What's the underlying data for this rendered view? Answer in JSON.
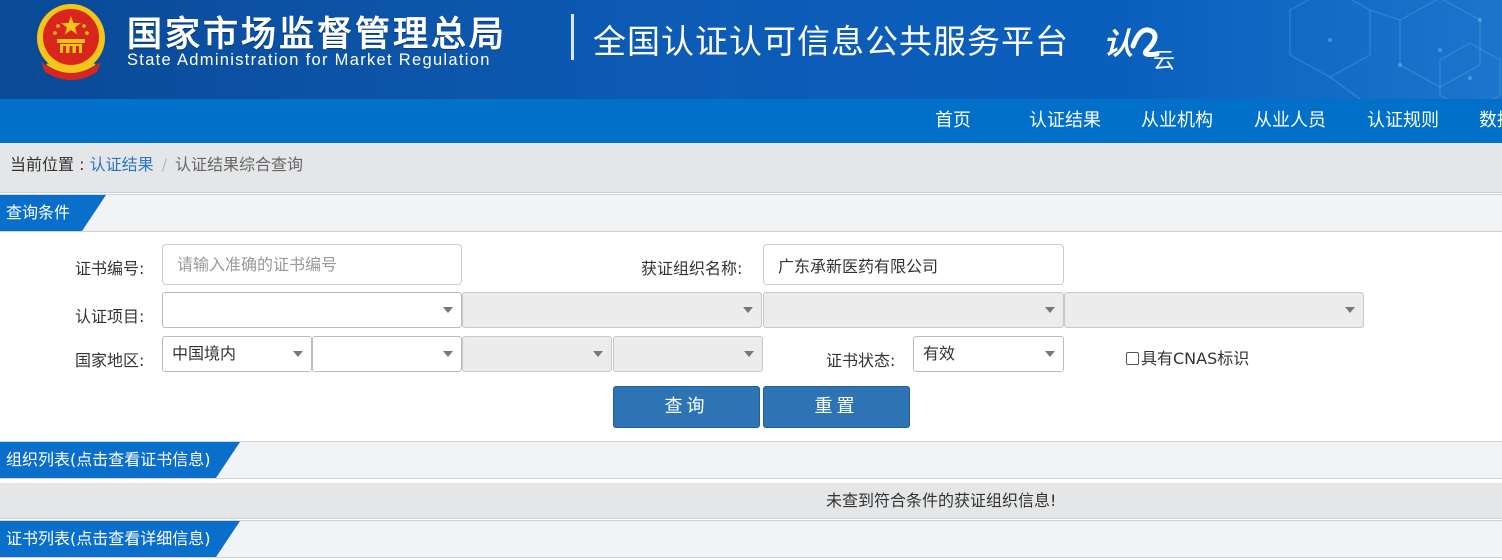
{
  "header": {
    "org_name_cn": "国家市场监督管理总局",
    "org_name_en": "State Administration  for  Market Regulation",
    "platform_title": "全国认证认可信息公共服务平台",
    "logo_text": "认",
    "logo_text_2": "云",
    "colors": {
      "header_blue": "#0d5bb5",
      "nav_blue": "#0070c8",
      "emblem_red": "#d8261c",
      "emblem_gold": "#f5c518"
    }
  },
  "nav": {
    "items": [
      {
        "label": "首页"
      },
      {
        "label": "认证结果"
      },
      {
        "label": "从业机构"
      },
      {
        "label": "从业人员"
      },
      {
        "label": "认证规则"
      },
      {
        "label": "数据"
      }
    ]
  },
  "breadcrumb": {
    "label": "当前位置 : ",
    "link": "认证结果",
    "separator": "/",
    "current": "认证结果综合查询"
  },
  "query_section": {
    "title": "查询条件",
    "cert_no_label": "证书编号:",
    "cert_no_placeholder": "请输入准确的证书编号",
    "org_name_label": "获证组织名称:",
    "org_name_value": "广东承新医药有限公司",
    "project_label": "认证项目:",
    "project_selects": [
      "",
      "",
      "",
      ""
    ],
    "region_label": "国家地区:",
    "region_selects": [
      "中国境内",
      "",
      "",
      ""
    ],
    "status_label": "证书状态:",
    "status_value": "有效",
    "cnas_label": "具有CNAS标识",
    "search_button": "查询",
    "reset_button": "重置"
  },
  "org_section": {
    "title": "组织列表(点击查看证书信息)",
    "empty_message": "未查到符合条件的获证组织信息!"
  },
  "cert_section": {
    "title": "证书列表(点击查看详细信息)"
  }
}
